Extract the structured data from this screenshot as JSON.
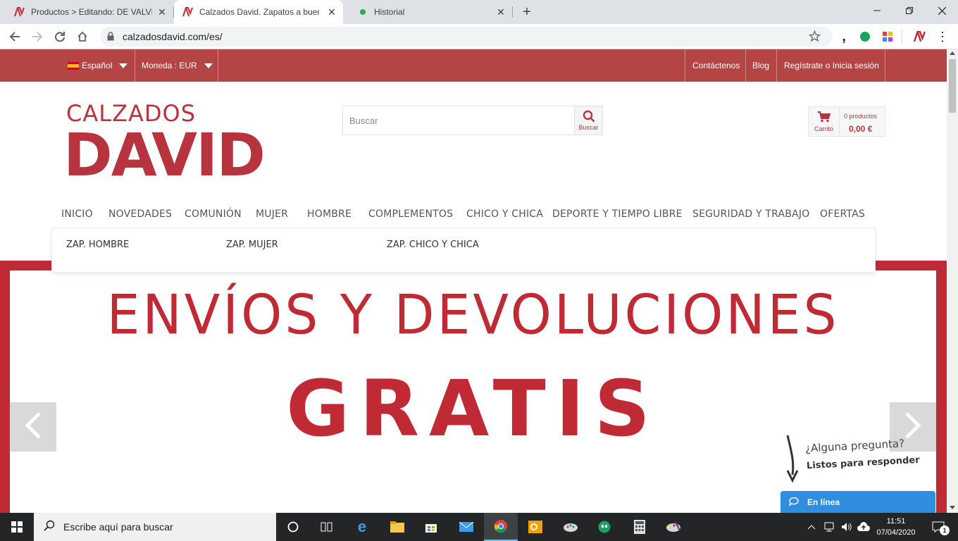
{
  "browser": {
    "tabs": [
      {
        "title": "Productos > Editando: DE VALVERDE",
        "active": false
      },
      {
        "title": "Calzados David. Zapatos a buen precio",
        "active": true
      },
      {
        "title": "Historial",
        "active": false
      }
    ],
    "new_tab_symbol": "+",
    "url": "calzadosdavid.com/es/"
  },
  "topbar": {
    "language": "Español",
    "currency": "Moneda : EUR",
    "links": [
      "Contáctenos",
      "Blog",
      "Regístrate o Inicia sesión"
    ]
  },
  "header": {
    "logo_top": "CALZADOS",
    "logo_main": "DAVID",
    "search_placeholder": "Buscar",
    "search_button_label": "Buscar",
    "cart_label": "Carrito",
    "cart_count": "0 productos",
    "cart_total": "0,00 €"
  },
  "nav": {
    "items": [
      "INICIO",
      "NOVEDADES",
      "COMUNIÓN",
      "MUJER",
      "HOMBRE",
      "COMPLEMENTOS",
      "CHICO Y CHICA",
      "DEPORTE Y TIEMPO LIBRE",
      "SEGURIDAD Y TRABAJO",
      "OFERTAS"
    ],
    "submenu": [
      "ZAP. HOMBRE",
      "ZAP. MUJER",
      "ZAP. CHICO Y CHICA"
    ]
  },
  "hero": {
    "line1": "ENVÍOS Y DEVOLUCIONES",
    "line2": "GRATIS"
  },
  "chat": {
    "question": "¿Alguna pregunta?",
    "subtitle": "Listos para responder",
    "button": "En línea"
  },
  "taskbar": {
    "search_placeholder": "Escribe aquí para buscar",
    "time": "11:51",
    "date": "07/04/2020",
    "notification_count": "1"
  },
  "colors": {
    "brand_red": "#b54545",
    "logo_red": "#b7343e",
    "hero_red": "#c02a35",
    "chat_blue": "#2f8ee0"
  }
}
